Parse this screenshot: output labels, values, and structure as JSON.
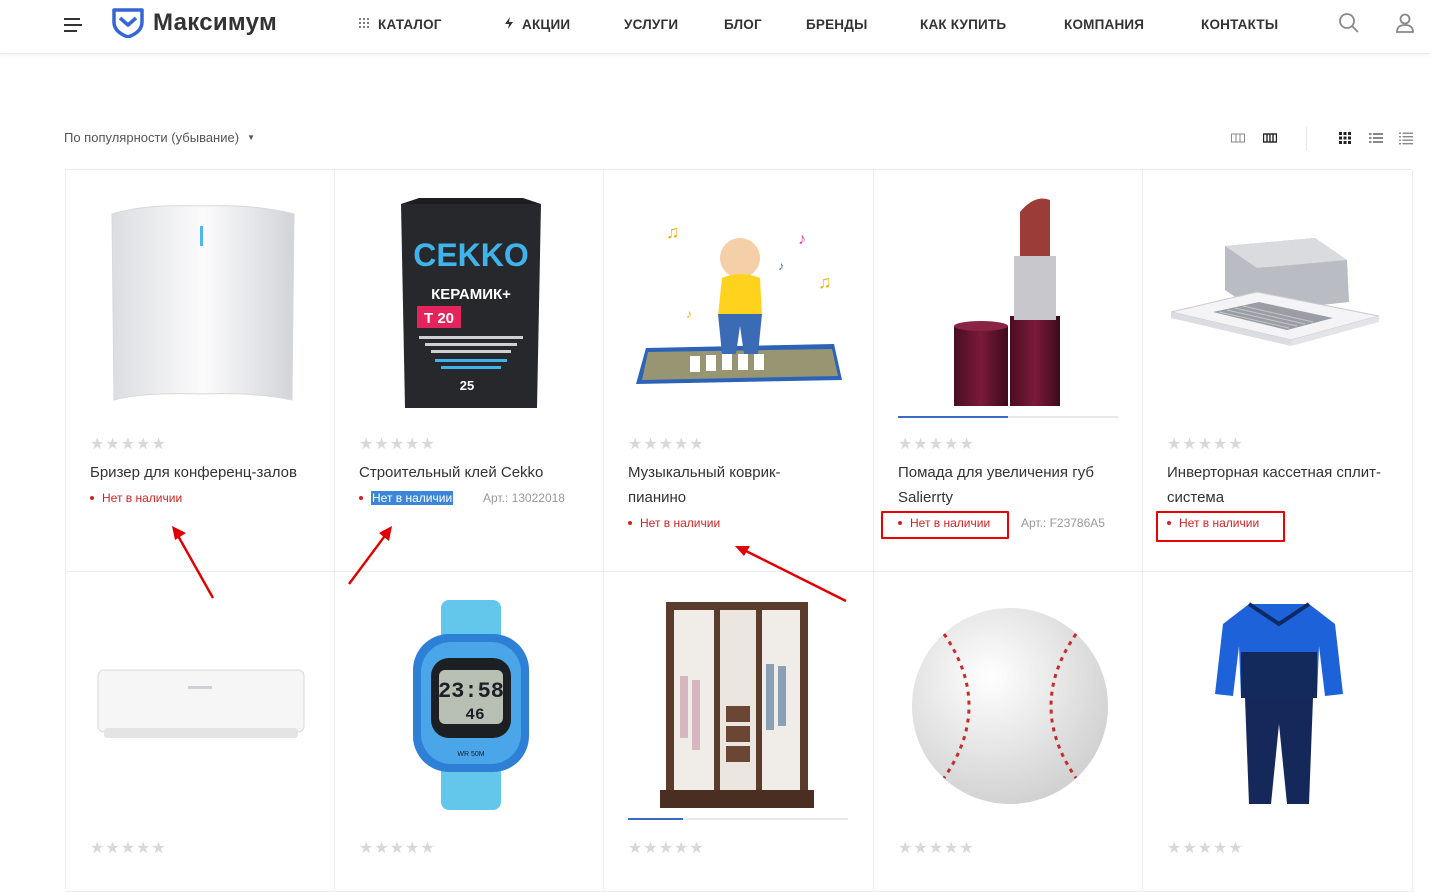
{
  "header": {
    "logo_text": "Максимум",
    "nav": [
      {
        "label": "Каталог",
        "icon": "grid-dots-icon"
      },
      {
        "label": "Акции",
        "icon": "lightning-icon"
      },
      {
        "label": "Услуги"
      },
      {
        "label": "Блог"
      },
      {
        "label": "Бренды"
      },
      {
        "label": "Как купить"
      },
      {
        "label": "Компания"
      },
      {
        "label": "Контакты"
      }
    ]
  },
  "toolbar": {
    "sort_label": "По популярности (убывание)"
  },
  "products": [
    {
      "name": "Бризер для конференц-залов",
      "stock": "Нет в наличии",
      "art": ""
    },
    {
      "name": "Строительный клей Cekko",
      "stock": "Нет в наличии",
      "art": "Арт.: 13022018"
    },
    {
      "name": "Музыкальный коврик-пианино",
      "stock": "Нет в наличии",
      "art": ""
    },
    {
      "name": "Помада для увеличения губ Salierrty",
      "stock": "Нет в наличии",
      "art": "Арт.: F23786A5"
    },
    {
      "name": "Инверторная кассетная сплит-система",
      "stock": "Нет в наличии",
      "art": ""
    }
  ],
  "images": {
    "cekko_brand": "CEKKO",
    "cekko_line": "КЕРАМИК+",
    "cekko_code": "T 20",
    "watch_time": "23:58",
    "watch_sec": "46"
  },
  "rating_stars": "★★★★★",
  "colors": {
    "accent": "#3c6bc4",
    "out_of_stock": "#d12323",
    "annotation": "#e00000"
  }
}
